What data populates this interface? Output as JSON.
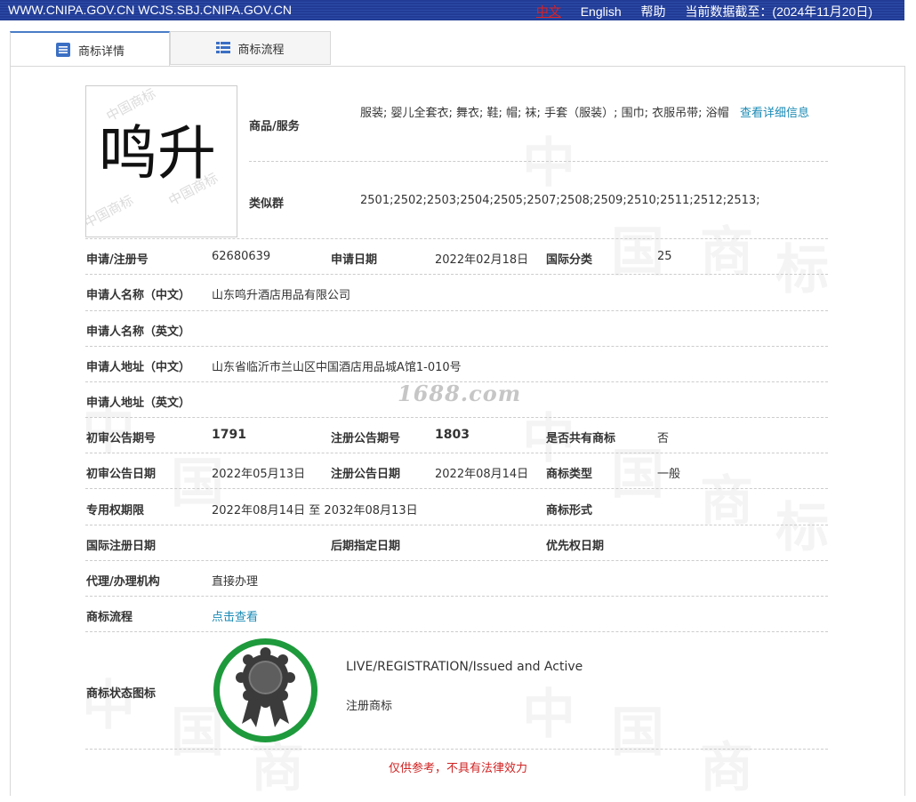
{
  "topbar": {
    "site_urls": "WWW.CNIPA.GOV.CN WCJS.SBJ.CNIPA.GOV.CN",
    "lang_zh": "中文",
    "lang_en": "English",
    "help": "帮助",
    "data_cutoff": "当前数据截至：(2024年11月20日)"
  },
  "tabs": [
    {
      "label": "商标详情",
      "icon": "document-list-icon"
    },
    {
      "label": "商标流程",
      "icon": "table-grid-icon"
    }
  ],
  "trademark": {
    "image_text": "鸣升"
  },
  "goods": {
    "label": "商品/服务",
    "value": "服装; 婴儿全套衣; 舞衣; 鞋; 帽; 袜; 手套（服装）; 围巾; 衣服吊带; 浴帽",
    "more_link": "查看详细信息"
  },
  "similar_groups": {
    "label": "类似群",
    "value": "2501;2502;2503;2504;2505;2507;2508;2509;2510;2511;2512;2513;"
  },
  "details": {
    "reg_no_label": "申请/注册号",
    "reg_no": "62680639",
    "app_date_label": "申请日期",
    "app_date": "2022年02月18日",
    "intl_class_label": "国际分类",
    "intl_class": "25",
    "applicant_cn_label": "申请人名称（中文）",
    "applicant_cn": "山东鸣升酒店用品有限公司",
    "applicant_en_label": "申请人名称（英文）",
    "address_cn_label": "申请人地址（中文）",
    "address_cn": "山东省临沂市兰山区中国酒店用品城A馆1-010号",
    "address_en_label": "申请人地址（英文）",
    "prelim_issue_label": "初审公告期号",
    "prelim_issue": "1791",
    "reg_issue_label": "注册公告期号",
    "reg_issue": "1803",
    "shared_label": "是否共有商标",
    "shared": "否",
    "prelim_date_label": "初审公告日期",
    "prelim_date": "2022年05月13日",
    "reg_date_label": "注册公告日期",
    "reg_date": "2022年08月14日",
    "tm_type_label": "商标类型",
    "tm_type": "一般",
    "exclusive_label": "专用权期限",
    "exclusive": "2022年08月14日 至 2032年08月13日",
    "tm_form_label": "商标形式",
    "intl_reg_date_label": "国际注册日期",
    "later_designation_label": "后期指定日期",
    "priority_date_label": "优先权日期",
    "agent_label": "代理/办理机构",
    "agent": "直接办理",
    "process_label": "商标流程",
    "process_link": "点击查看",
    "status_icon_label": "商标状态图标"
  },
  "status": {
    "en": "LIVE/REGISTRATION/Issued and Active",
    "cn": "注册商标",
    "icon": "registered-seal-icon",
    "ring_color": "#1e9a3c"
  },
  "watermark_site": "1688.com",
  "disclaimer": "仅供参考，不具有法律效力"
}
